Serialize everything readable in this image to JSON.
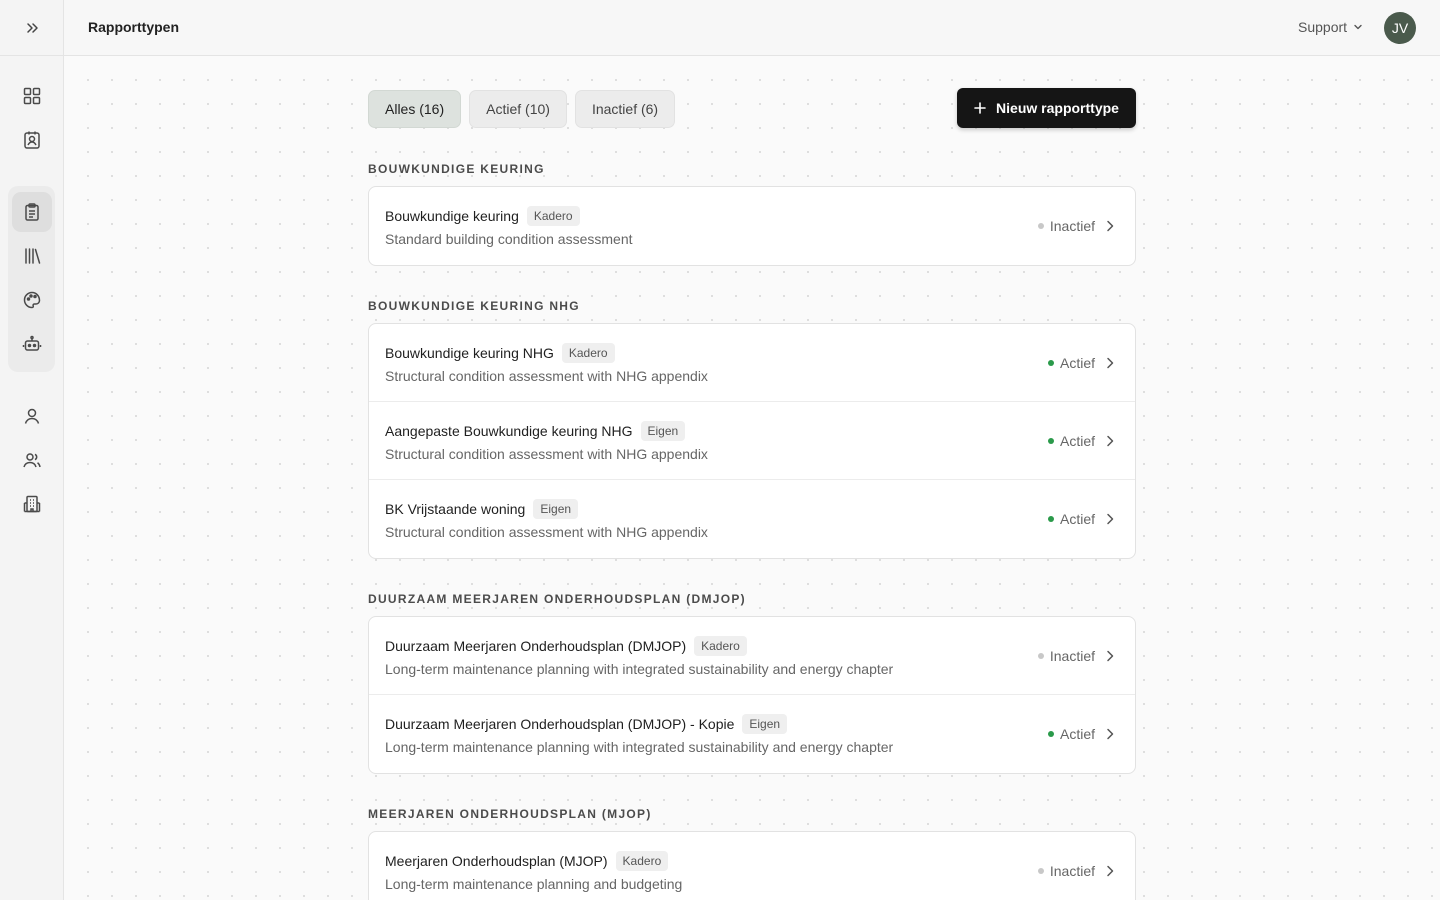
{
  "header": {
    "page_title": "Rapporttypen",
    "support_label": "Support",
    "avatar_initials": "JV"
  },
  "filters": [
    {
      "label": "Alles (16)",
      "active": true
    },
    {
      "label": "Actief (10)",
      "active": false
    },
    {
      "label": "Inactief (6)",
      "active": false
    }
  ],
  "new_button_label": "Nieuw rapporttype",
  "sections": [
    {
      "title": "BOUWKUNDIGE KEURING",
      "items": [
        {
          "name": "Bouwkundige keuring",
          "badge": "Kadero",
          "description": "Standard building condition assessment",
          "status": "Inactief",
          "active": false
        }
      ]
    },
    {
      "title": "BOUWKUNDIGE KEURING NHG",
      "items": [
        {
          "name": "Bouwkundige keuring NHG",
          "badge": "Kadero",
          "description": "Structural condition assessment with NHG appendix",
          "status": "Actief",
          "active": true
        },
        {
          "name": "Aangepaste Bouwkundige keuring NHG",
          "badge": "Eigen",
          "description": "Structural condition assessment with NHG appendix",
          "status": "Actief",
          "active": true
        },
        {
          "name": "BK Vrijstaande woning",
          "badge": "Eigen",
          "description": "Structural condition assessment with NHG appendix",
          "status": "Actief",
          "active": true
        }
      ]
    },
    {
      "title": "DUURZAAM MEERJAREN ONDERHOUDSPLAN (DMJOP)",
      "items": [
        {
          "name": "Duurzaam Meerjaren Onderhoudsplan (DMJOP)",
          "badge": "Kadero",
          "description": "Long-term maintenance planning with integrated sustainability and energy chapter",
          "status": "Inactief",
          "active": false
        },
        {
          "name": "Duurzaam Meerjaren Onderhoudsplan (DMJOP) - Kopie",
          "badge": "Eigen",
          "description": "Long-term maintenance planning with integrated sustainability and energy chapter",
          "status": "Actief",
          "active": true
        }
      ]
    },
    {
      "title": "MEERJAREN ONDERHOUDSPLAN (MJOP)",
      "items": [
        {
          "name": "Meerjaren Onderhoudsplan (MJOP)",
          "badge": "Kadero",
          "description": "Long-term maintenance planning and budgeting",
          "status": "Inactief",
          "active": false
        }
      ]
    }
  ],
  "sidebar": {
    "icons": [
      "dashboard-icon",
      "contact-card-icon",
      "clipboard-icon",
      "library-icon",
      "palette-icon",
      "robot-icon",
      "user-icon",
      "users-icon",
      "building-icon"
    ],
    "active_icon": "clipboard-icon"
  },
  "colors": {
    "active_dot": "#2a9a4a",
    "inactive_dot": "#c8c8c8",
    "primary_button": "#151515",
    "avatar_bg": "#4a5a4c"
  }
}
